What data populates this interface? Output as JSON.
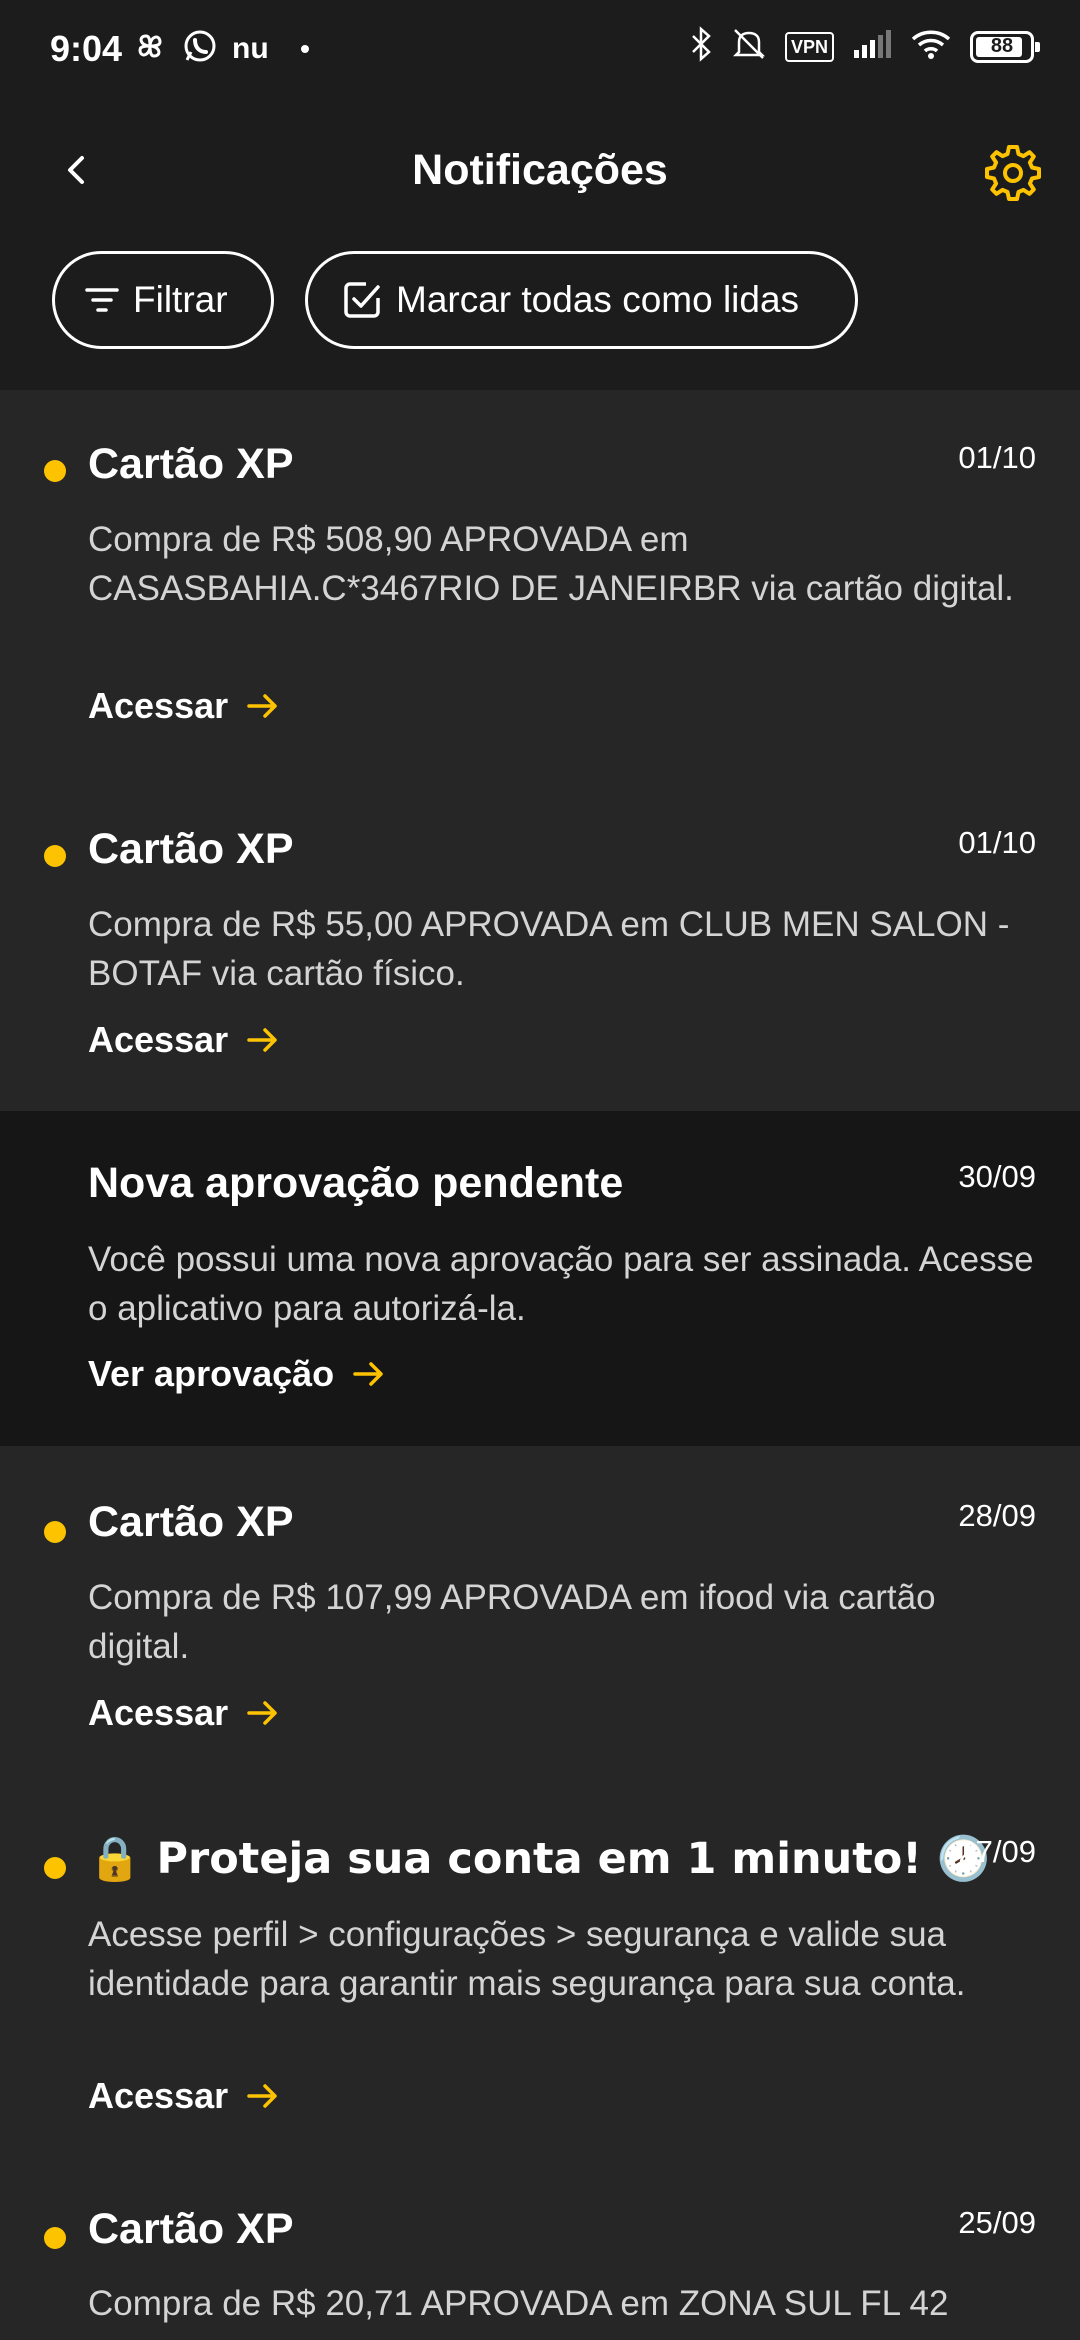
{
  "status_bar": {
    "time": "9:04",
    "left_icons": [
      "pinwheel-icon",
      "whatsapp-icon",
      "nubank-icon",
      "dot-icon"
    ],
    "nubank_label": "nu",
    "vpn_label": "VPN",
    "battery": "88",
    "battery_level": 0.88
  },
  "header": {
    "title": "Notificações",
    "filter_label": "Filtrar",
    "mark_all_label": "Marcar todas como lidas"
  },
  "colors": {
    "accent": "#fdc300",
    "background": "#1c1c1c",
    "unread_card": "#262626",
    "read_card": "#161616"
  },
  "notifications": [
    {
      "title": "Cartão XP",
      "date": "01/10",
      "body": "Compra de R$ 508,90 APROVADA em CASASBAHIA.C*3467RIO DE JANEIRBR via cartão digital.",
      "action": "Acessar",
      "unread": true
    },
    {
      "title": "Cartão XP",
      "date": "01/10",
      "body": "Compra de R$ 55,00 APROVADA em CLUB MEN SALON - BOTAF via cartão físico.",
      "action": "Acessar",
      "unread": true
    },
    {
      "title": "Nova aprovação pendente",
      "date": "30/09",
      "body": "Você possui uma nova aprovação para ser assinada. Acesse o aplicativo para autorizá-la.",
      "action": "Ver aprovação",
      "unread": false
    },
    {
      "title": "Cartão XP",
      "date": "28/09",
      "body": "Compra de R$ 107,99 APROVADA em ifood via cartão digital.",
      "action": "Acessar",
      "unread": true
    },
    {
      "title": "🔒 Proteja sua conta em 1 minuto! 🕗",
      "date": "27/09",
      "body": "Acesse perfil > configurações > segurança e valide sua identidade para garantir mais segurança para sua conta.",
      "action": "Acessar",
      "unread": true
    },
    {
      "title": "Cartão XP",
      "date": "25/09",
      "body": "Compra de R$ 20,71 APROVADA em ZONA SUL FL 42",
      "action": "",
      "unread": true
    }
  ]
}
